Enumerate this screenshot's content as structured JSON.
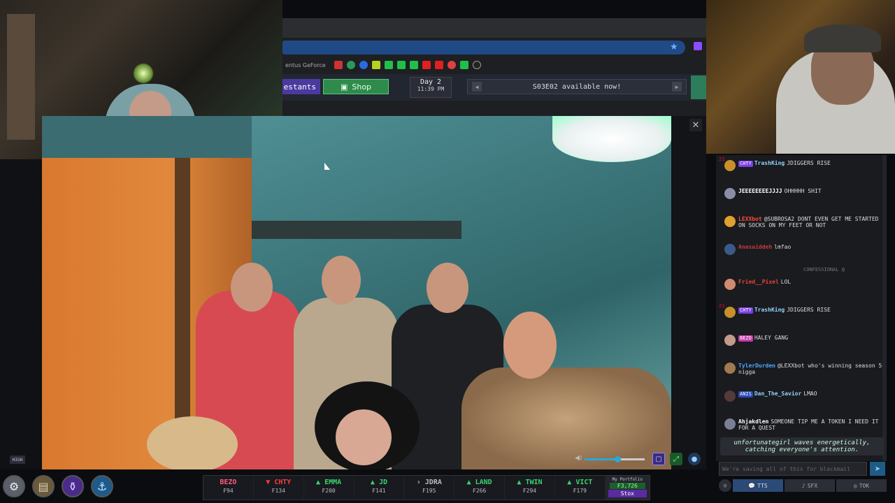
{
  "header": {
    "bookmark_text": "entus GeForce...",
    "contestants_label": "estants",
    "shop_label": "Shop",
    "day_label": "Day 2",
    "time_label": "11:39 PM",
    "announcement": "S03E02 available now!"
  },
  "video": {
    "quality_label": "HIGH",
    "volume_level": 0.55
  },
  "chat": {
    "messages": [
      {
        "num": "21",
        "tag": "CHTY",
        "tag_color": "#7b3fe4",
        "user": "TrashKing",
        "user_color": "#8fd3ff",
        "text": "JDIGGERS RISE",
        "avatar": "#c7902a"
      },
      {
        "num": "",
        "tag": "",
        "tag_color": "",
        "user": "JEEEEEEEEJJJJ",
        "user_color": "#ffffff",
        "text": "OHHHHH SHIT",
        "avatar": "#8a8fa6"
      },
      {
        "num": "",
        "tag": "",
        "tag_color": "",
        "user": "LEXXbot",
        "user_color": "#ff4a3d",
        "text": "@SUBROSA2 DONT EVEN GET ME STARTED ON SOCKS ON MY FEET OR NOT",
        "avatar": "#e0a030"
      },
      {
        "num": "",
        "tag": "",
        "tag_color": "",
        "user": "Anasaiddeh",
        "user_color": "#c43a3a",
        "text": "lmfao",
        "avatar": "#3a5a8a"
      },
      {
        "num": "",
        "tag": "",
        "tag_color": "",
        "user": "Fried__Pixel",
        "user_color": "#e0453a",
        "text": "LOL",
        "avatar": "#d08a70"
      },
      {
        "num": "21",
        "tag": "CHTY",
        "tag_color": "#7b3fe4",
        "user": "TrashKing",
        "user_color": "#8fd3ff",
        "text": "JDIGGERS RISE",
        "avatar": "#c7902a"
      },
      {
        "num": "",
        "tag": "BEZO",
        "tag_color": "#c43aa8",
        "user": "",
        "user_color": "#cc3333",
        "text": "HALEY GANG",
        "avatar": "#c49a8a"
      },
      {
        "num": "",
        "tag": "",
        "tag_color": "",
        "user": "TylerDurden",
        "user_color": "#4aa8ff",
        "text": "@LEXXbot who's winning season 5 nigga",
        "avatar": "#a07a50"
      },
      {
        "num": "",
        "tag": "ANIS",
        "tag_color": "#2a4ab8",
        "user": "Dan_The_Savior",
        "user_color": "#8fd3ff",
        "text": "LMAO",
        "avatar": "#553a3a"
      },
      {
        "num": "",
        "tag": "",
        "tag_color": "",
        "user": "Ahjakdlen",
        "user_color": "#ffffff",
        "text": "SOMEONE TIP ME A TOKEN I NEED IT FOR A QUEST",
        "avatar": "#7a7f96"
      }
    ],
    "system_line": "CONFESSIONAL @",
    "action_text": "unfortunategirl waves energetically, catching everyone's attention.",
    "input_placeholder": "We're saving all of this for blackmail",
    "tabs": [
      "TTS",
      "SFX",
      "TOK"
    ]
  },
  "ticker": [
    {
      "name": "BEZO",
      "value": "₣94",
      "trend": "",
      "color": "#ff5a7a"
    },
    {
      "name": "CHTY",
      "value": "₣134",
      "trend": "▼",
      "color": "#ff3b3b"
    },
    {
      "name": "EMMA",
      "value": "₣200",
      "trend": "▲",
      "color": "#3bd36b"
    },
    {
      "name": "JD",
      "value": "₣141",
      "trend": "▲",
      "color": "#3bd36b"
    },
    {
      "name": "JDRA",
      "value": "₣195",
      "trend": "›",
      "color": "#bbbbbb"
    },
    {
      "name": "LAND",
      "value": "₣266",
      "trend": "▲",
      "color": "#3bd36b"
    },
    {
      "name": "TWIN",
      "value": "₣294",
      "trend": "▲",
      "color": "#3bd36b"
    },
    {
      "name": "VICT",
      "value": "₣179",
      "trend": "▲",
      "color": "#3bd36b"
    }
  ],
  "portfolio": {
    "label": "My Portfolio",
    "value": "₣3,726",
    "button": "Stox"
  }
}
